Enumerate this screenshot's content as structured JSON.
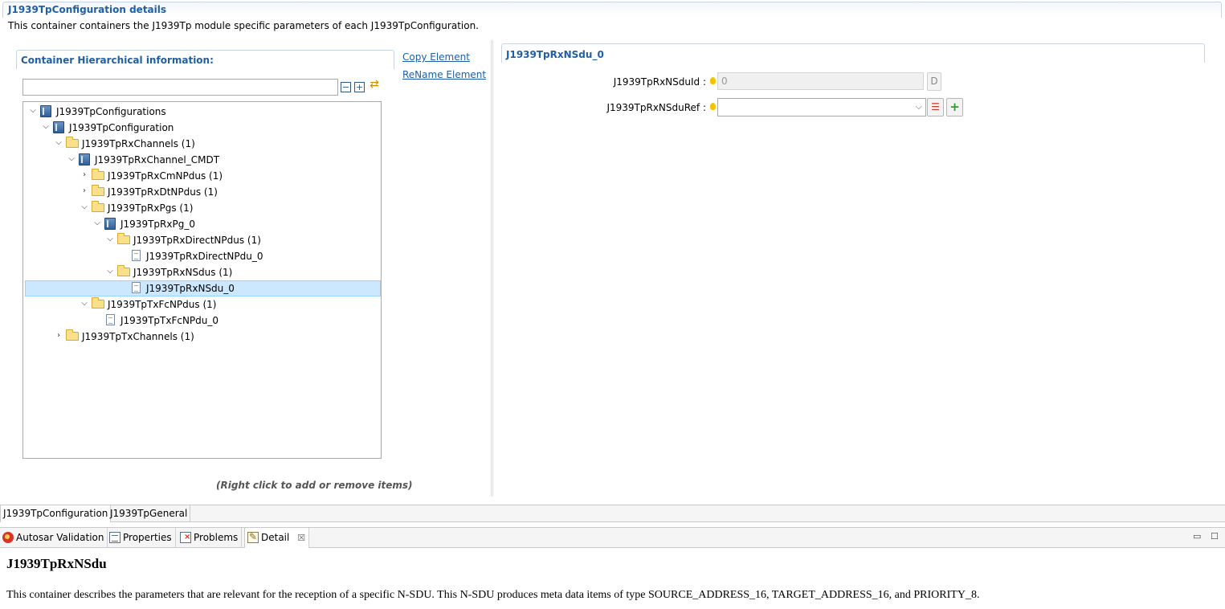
{
  "header": {
    "title": "J1939TpConfiguration details",
    "description": "This container containers the J1939Tp module specific parameters of each J1939TpConfiguration."
  },
  "left_panel": {
    "title": "Container Hierarchical information:",
    "filter_value": "",
    "tree": [
      {
        "label": "J1939TpConfigurations",
        "icon": "module-icon",
        "expander": "expanded"
      },
      {
        "label": "J1939TpConfiguration",
        "icon": "module-icon",
        "expander": "expanded"
      },
      {
        "label": "J1939TpRxChannels (1)",
        "icon": "folder-icon",
        "expander": "expanded"
      },
      {
        "label": "J1939TpRxChannel_CMDT",
        "icon": "module-icon",
        "expander": "expanded"
      },
      {
        "label": "J1939TpRxCmNPdus (1)",
        "icon": "folder-icon",
        "expander": "collapsed"
      },
      {
        "label": "J1939TpRxDtNPdus (1)",
        "icon": "folder-icon",
        "expander": "collapsed"
      },
      {
        "label": "J1939TpRxPgs (1)",
        "icon": "folder-icon",
        "expander": "expanded"
      },
      {
        "label": "J1939TpRxPg_0",
        "icon": "module-icon",
        "expander": "expanded"
      },
      {
        "label": "J1939TpRxDirectNPdus (1)",
        "icon": "folder-icon",
        "expander": "expanded"
      },
      {
        "label": "J1939TpRxDirectNPdu_0",
        "icon": "document-icon",
        "expander": "none"
      },
      {
        "label": "J1939TpRxNSdus (1)",
        "icon": "folder-icon",
        "expander": "expanded"
      },
      {
        "label": "J1939TpRxNSdu_0",
        "icon": "document-icon",
        "expander": "none",
        "selected": true
      },
      {
        "label": "J1939TpTxFcNPdus (1)",
        "icon": "folder-icon",
        "expander": "expanded"
      },
      {
        "label": "J1939TpTxFcNPdu_0",
        "icon": "document-icon",
        "expander": "none"
      },
      {
        "label": "J1939TpTxChannels (1)",
        "icon": "folder-icon",
        "expander": "collapsed"
      }
    ],
    "hint": "(Right click to add or remove items)"
  },
  "actions": {
    "copy": "Copy Element",
    "rename": "ReName Element"
  },
  "right_panel": {
    "title": "J1939TpRxNSdu_0",
    "fields": {
      "id_label": "J1939TpRxNSduId :",
      "id_value": "0",
      "id_default_button": "D",
      "ref_label": "J1939TpRxNSduRef :",
      "ref_value": ""
    }
  },
  "editor_tabs": [
    {
      "label": "J1939TpConfiguration",
      "active": true
    },
    {
      "label": "J1939TpGeneral",
      "active": false
    }
  ],
  "views": [
    {
      "label": "Autosar Validation",
      "icon": "validation-icon"
    },
    {
      "label": "Properties",
      "icon": "properties-icon"
    },
    {
      "label": "Problems",
      "icon": "problems-icon"
    },
    {
      "label": "Detail",
      "icon": "detail-icon",
      "active": true,
      "closable": true
    }
  ],
  "detail": {
    "title": "J1939TpRxNSdu",
    "description": "This container describes the parameters that are relevant for the reception of a specific N-SDU. This N-SDU produces meta data items of type SOURCE_ADDRESS_16, TARGET_ADDRESS_16, and PRIORITY_8."
  },
  "colors": {
    "accent": "#1f5fa8",
    "selection": "#cce8ff"
  }
}
